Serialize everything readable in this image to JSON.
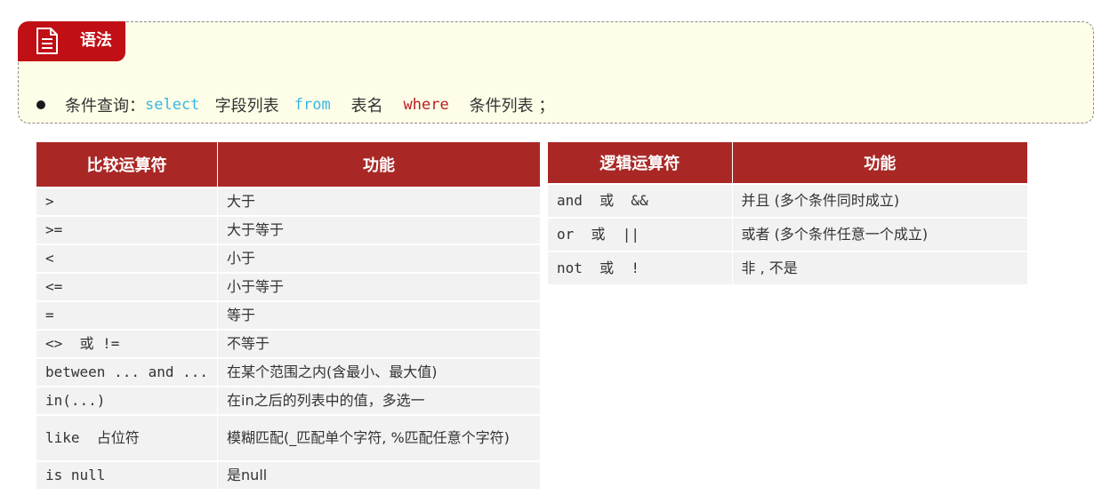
{
  "syntax": {
    "tag_label": "语法",
    "line": {
      "prefix": "条件查询：",
      "select_kw": "select",
      "fields": "字段列表",
      "from_kw": "from",
      "table": "表名",
      "where_kw": "where",
      "conditions": "条件列表",
      "end": "；"
    }
  },
  "comparison_table": {
    "headers": [
      "比较运算符",
      "功能"
    ],
    "rows": [
      {
        "op": ">",
        "fn": "大于"
      },
      {
        "op": ">=",
        "fn": "大于等于"
      },
      {
        "op": "<",
        "fn": "小于"
      },
      {
        "op": "<=",
        "fn": "小于等于"
      },
      {
        "op": "=",
        "fn": "等于"
      },
      {
        "op": "<>  或 !=",
        "fn": "不等于"
      },
      {
        "op": "between ... and ...",
        "fn": "在某个范围之内(含最小、最大值)"
      },
      {
        "op": "in(...)",
        "fn": "在in之后的列表中的值，多选一"
      },
      {
        "op": "like  占位符",
        "fn": "模糊匹配(_匹配单个字符, %匹配任意个字符)"
      },
      {
        "op": "is null",
        "fn": "是null"
      }
    ]
  },
  "logic_table": {
    "headers": [
      "逻辑运算符",
      "功能"
    ],
    "rows": [
      {
        "op": "and  或  &&",
        "fn": "并且 (多个条件同时成立)"
      },
      {
        "op": "or  或  ||",
        "fn": "或者 (多个条件任意一个成立)"
      },
      {
        "op": "not  或  !",
        "fn": "非 , 不是"
      }
    ]
  },
  "colors": {
    "tag_bg": "#c00f15",
    "header_bg": "#a92826",
    "box_bg": "#fefee8",
    "keyword_blue": "#37b6e6",
    "keyword_red": "#b81d20",
    "cell_bg": "#f2f2f2"
  },
  "icons": {
    "tag_icon": "document-icon"
  }
}
